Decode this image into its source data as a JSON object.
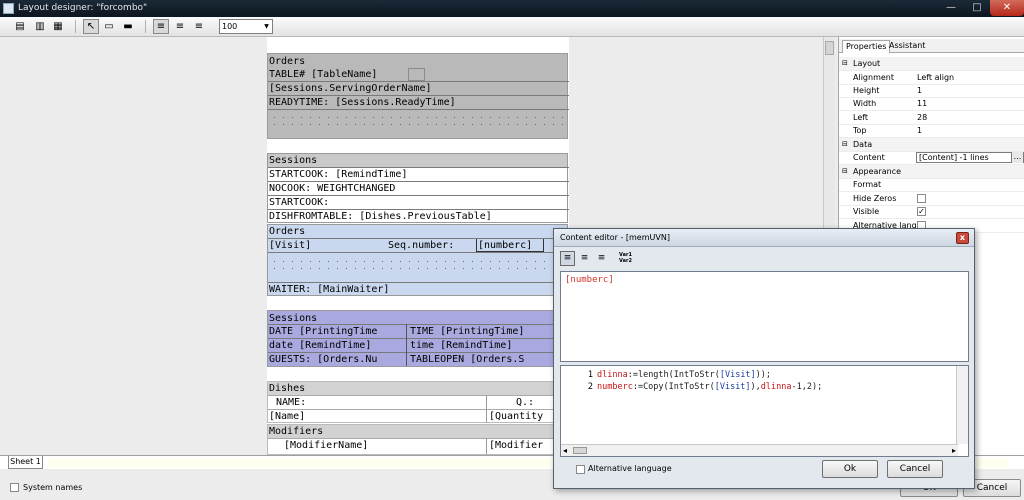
{
  "window": {
    "title": "Layout designer: \"forcombo\"",
    "min": "—",
    "max": "□",
    "close": "✕"
  },
  "toolbar": {
    "zoom_value": "100"
  },
  "canvas": {
    "orders1": {
      "title": "Orders",
      "table": "TABLE# [TableName]",
      "serving": "[Sessions.ServingOrderName]",
      "ready": "READYTIME: [Sessions.ReadyTime]"
    },
    "sessions1": {
      "title": "Sessions",
      "startcook1": "STARTCOOK: [RemindTime]",
      "nocook": "NOCOOK: WEIGHTCHANGED",
      "startcook2": "STARTCOOK:",
      "dishfrom": "DISHFROMTABLE: [Dishes.PreviousTable]"
    },
    "orders2": {
      "title": "Orders",
      "visit": "[Visit]",
      "seq": "Seq.number:",
      "numberc": "[numberc]",
      "waiter": "WAITER: [MainWaiter]"
    },
    "sessions2": {
      "title": "Sessions",
      "date1": "DATE [PrintingTime",
      "time1": "TIME [PrintingTime]",
      "date2": "date [RemindTime]",
      "time2": "time [RemindTime]",
      "guests": "GUESTS: [Orders.Nu",
      "tableopen": "TABLEOPEN [Orders.S"
    },
    "dishes": {
      "title": "Dishes",
      "name_hdr": "NAME:",
      "q_hdr": "Q.:",
      "name": "[Name]",
      "quantity": "[Quantity"
    },
    "modifiers": {
      "title": "Modifiers",
      "modname": "[ModifierName]",
      "modifier": "[Modifier"
    }
  },
  "properties": {
    "tabs": [
      "Properties",
      "Assistant"
    ],
    "layout_cat": "Layout",
    "alignment": {
      "key": "Alignment",
      "value": "Left align"
    },
    "height": {
      "key": "Height",
      "value": "1"
    },
    "width": {
      "key": "Width",
      "value": "11"
    },
    "left": {
      "key": "Left",
      "value": "28"
    },
    "top": {
      "key": "Top",
      "value": "1"
    },
    "data_cat": "Data",
    "content": {
      "key": "Content",
      "value": "[Content] -1 lines",
      "button": "..."
    },
    "appearance_cat": "Appearance",
    "format": {
      "key": "Format"
    },
    "hidezeros": {
      "key": "Hide Zeros"
    },
    "visible": {
      "key": "Visible",
      "check": "✓"
    },
    "altlang": {
      "key": "Alternative langu"
    }
  },
  "sheet": {
    "tab": "Sheet 1"
  },
  "status": {
    "system_names": "System names",
    "ok": "OK",
    "cancel": "Cancel"
  },
  "dialog": {
    "title": "Content editor - [memUVN]",
    "close": "x",
    "var_icon": "Var1 Var2",
    "memo_text": "[numberc]",
    "code": [
      {
        "num": "1",
        "var": "dlinna",
        "rest1": ":=length(IntToStr(",
        "ref": "[Visit]",
        "rest2": "));"
      },
      {
        "num": "2",
        "var": "numberc",
        "rest1": ":=Copy(IntToStr(",
        "ref": "[Visit]",
        "rest2": "),",
        "var2": "dlinna",
        "rest3": "-1,2);"
      }
    ],
    "alt_language": "Alternative language",
    "ok": "Ok",
    "cancel": "Cancel"
  }
}
